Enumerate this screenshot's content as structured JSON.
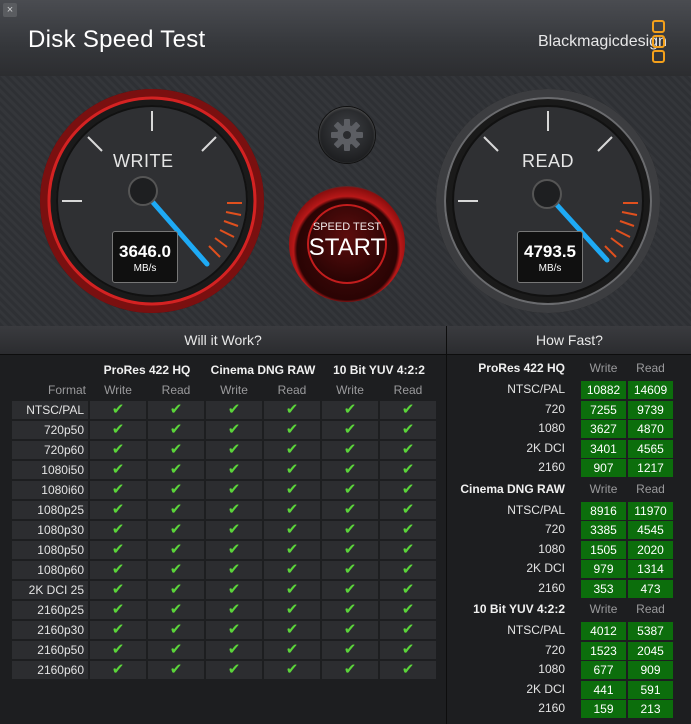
{
  "window": {
    "title": "Disk Speed Test",
    "brand": "Blackmagicdesign",
    "close_glyph": "×"
  },
  "gauges": {
    "write": {
      "label": "WRITE",
      "value": "3646.0",
      "unit": "MB/s"
    },
    "read": {
      "label": "READ",
      "value": "4793.5",
      "unit": "MB/s"
    }
  },
  "start_button": {
    "small": "SPEED TEST",
    "big": "START"
  },
  "settings_icon": "gear-icon",
  "will_it_work": {
    "title": "Will it Work?",
    "format_header": "Format",
    "groups": [
      "ProRes 422 HQ",
      "Cinema DNG RAW",
      "10 Bit YUV 4:2:2"
    ],
    "col_write": "Write",
    "col_read": "Read",
    "check_glyph": "✔",
    "formats": [
      "NTSC/PAL",
      "720p50",
      "720p60",
      "1080i50",
      "1080i60",
      "1080p25",
      "1080p30",
      "1080p50",
      "1080p60",
      "2K DCI 25",
      "2160p25",
      "2160p30",
      "2160p50",
      "2160p60"
    ]
  },
  "how_fast": {
    "title": "How Fast?",
    "col_write": "Write",
    "col_read": "Read",
    "groups": [
      {
        "name": "ProRes 422 HQ",
        "rows": [
          {
            "label": "NTSC/PAL",
            "write": "10882",
            "read": "14609"
          },
          {
            "label": "720",
            "write": "7255",
            "read": "9739"
          },
          {
            "label": "1080",
            "write": "3627",
            "read": "4870"
          },
          {
            "label": "2K DCI",
            "write": "3401",
            "read": "4565"
          },
          {
            "label": "2160",
            "write": "907",
            "read": "1217"
          }
        ]
      },
      {
        "name": "Cinema DNG RAW",
        "rows": [
          {
            "label": "NTSC/PAL",
            "write": "8916",
            "read": "11970"
          },
          {
            "label": "720",
            "write": "3385",
            "read": "4545"
          },
          {
            "label": "1080",
            "write": "1505",
            "read": "2020"
          },
          {
            "label": "2K DCI",
            "write": "979",
            "read": "1314"
          },
          {
            "label": "2160",
            "write": "353",
            "read": "473"
          }
        ]
      },
      {
        "name": "10 Bit YUV 4:2:2",
        "rows": [
          {
            "label": "NTSC/PAL",
            "write": "4012",
            "read": "5387"
          },
          {
            "label": "720",
            "write": "1523",
            "read": "2045"
          },
          {
            "label": "1080",
            "write": "677",
            "read": "909"
          },
          {
            "label": "2K DCI",
            "write": "441",
            "read": "591"
          },
          {
            "label": "2160",
            "write": "159",
            "read": "213"
          }
        ]
      }
    ]
  },
  "colors": {
    "accent_red": "#c21d1d",
    "needle_blue": "#1eaaf5",
    "check_green": "#5bd43a",
    "speed_cell_green": "#0c6e0c",
    "brand_orange": "#f3a01b"
  }
}
